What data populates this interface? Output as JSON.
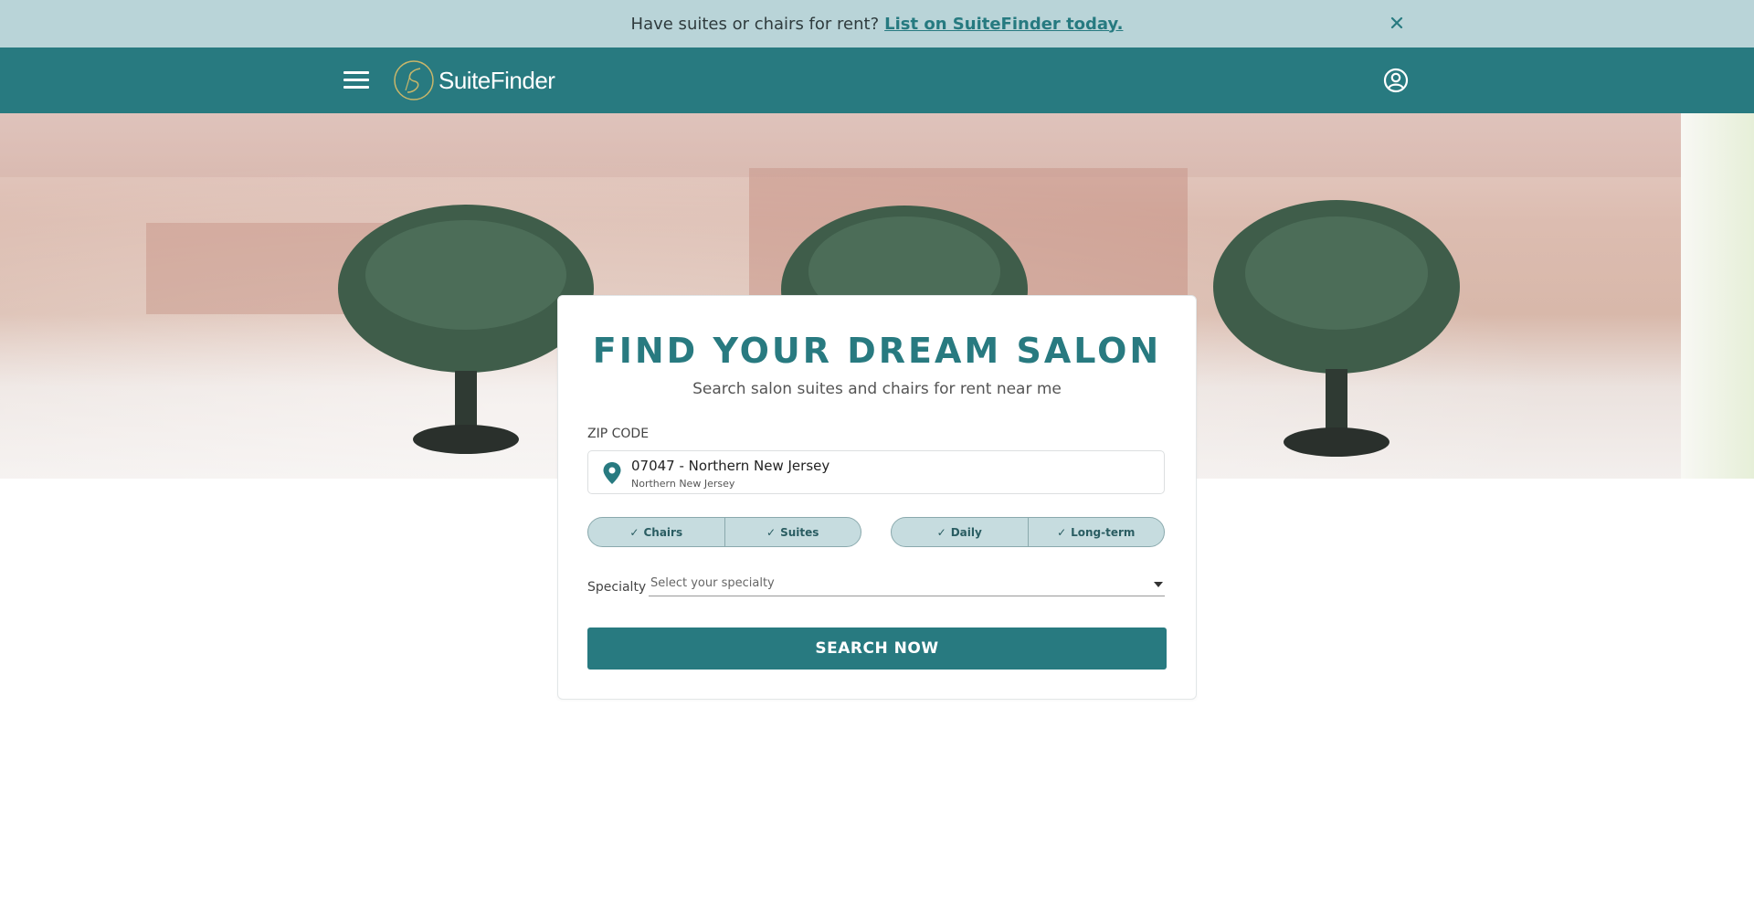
{
  "banner": {
    "text": "Have suites or chairs for rent?",
    "link_text": "List on SuiteFinder today."
  },
  "header": {
    "logo_text": "SuiteFinder",
    "brand_color": "#287a80",
    "accent_color": "#c8b66a"
  },
  "search": {
    "title": "FIND YOUR DREAM SALON",
    "subtitle": "Search salon suites and chairs for rent near me",
    "zip_label": "ZIP CODE",
    "zip_value": "07047 - Northern New Jersey",
    "zip_sub": "Northern New Jersey",
    "rental_types": [
      "Chairs",
      "Suites"
    ],
    "durations": [
      "Daily",
      "Long-term"
    ],
    "specialty_label": "Specialty",
    "specialty_placeholder": "Select your specialty",
    "button_label": "SEARCH NOW"
  },
  "icons": {
    "menu": "hamburger-menu-icon",
    "account": "user-circle-icon",
    "close": "close-icon",
    "location": "location-pin-icon",
    "check": "check-icon",
    "dropdown": "caret-down-icon"
  }
}
